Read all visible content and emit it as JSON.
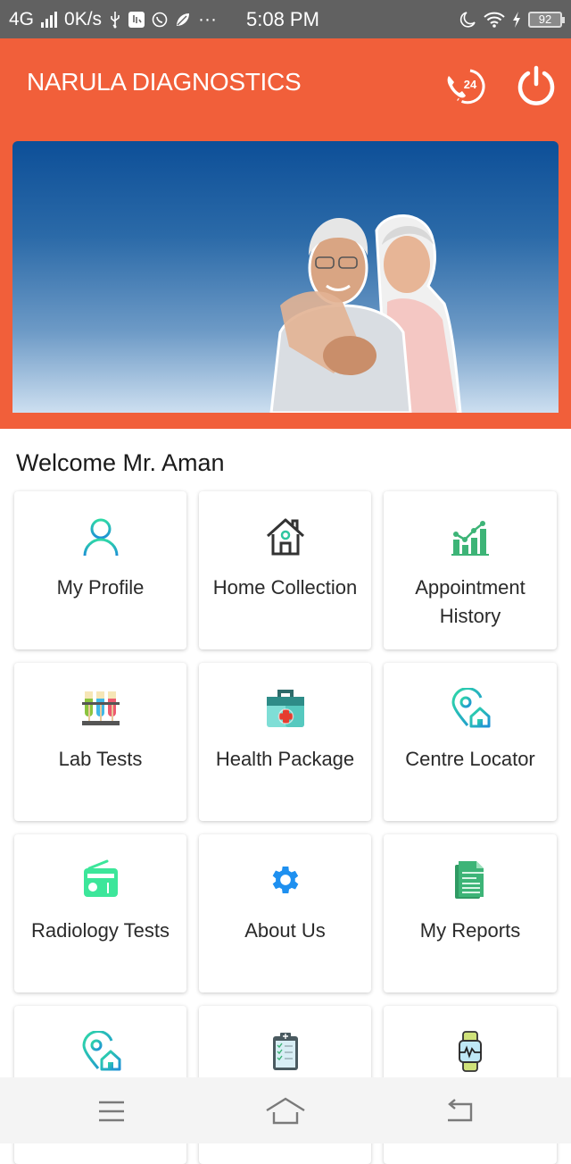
{
  "status_bar": {
    "network": "4G",
    "speed": "0K/s",
    "time": "5:08 PM",
    "battery": "92",
    "icons": [
      "signal-icon",
      "usb-icon",
      "app-notification-icon",
      "whatsapp-icon",
      "leaf-icon",
      "more-icon",
      "do-not-disturb-moon-icon",
      "wifi-icon",
      "charging-bolt-icon",
      "battery-icon"
    ],
    "more": "···"
  },
  "header": {
    "title": "NARULA DIAGNOSTICS",
    "support_icon": "24-hour-call-icon",
    "support_label": "24",
    "logout_icon": "power-icon",
    "brand_color": "#f15f3a"
  },
  "banner": {
    "image": "elderly-couple-embracing"
  },
  "welcome": "Welcome Mr. Aman",
  "tiles": [
    {
      "label": "My Profile",
      "icon": "user-icon"
    },
    {
      "label": "Home Collection",
      "icon": "home-icon"
    },
    {
      "label": "Appointment History",
      "icon": "chart-icon"
    },
    {
      "label": "Lab Tests",
      "icon": "test-tubes-icon"
    },
    {
      "label": "Health Package",
      "icon": "medical-kit-icon"
    },
    {
      "label": "Centre Locator",
      "icon": "location-home-icon"
    },
    {
      "label": "Radiology Tests",
      "icon": "radio-icon"
    },
    {
      "label": "About Us",
      "icon": "gear-icon"
    },
    {
      "label": "My Reports",
      "icon": "report-document-icon"
    },
    {
      "label": "",
      "icon": "location-home-icon"
    },
    {
      "label": "",
      "icon": "clipboard-icon"
    },
    {
      "label": "",
      "icon": "smartwatch-icon"
    }
  ],
  "nav_bar": {
    "menu": "menu-icon",
    "home": "home-icon",
    "back": "back-icon"
  }
}
